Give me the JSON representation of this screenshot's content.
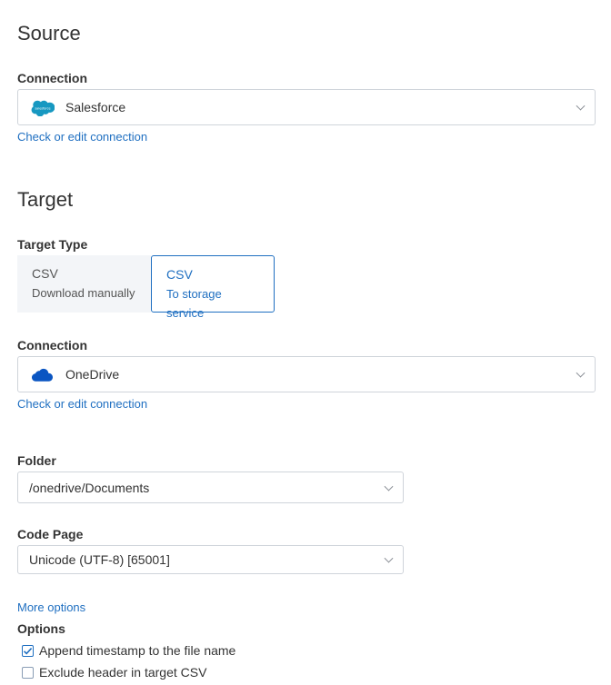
{
  "source": {
    "title": "Source",
    "connection_label": "Connection",
    "connection_value": "Salesforce",
    "connection_icon": "salesforce-icon",
    "edit_link": "Check or edit connection"
  },
  "target": {
    "title": "Target",
    "type_label": "Target Type",
    "types": [
      {
        "title": "CSV",
        "subtitle": "Download manually",
        "selected": false
      },
      {
        "title": "CSV",
        "subtitle": "To storage service",
        "selected": true
      }
    ],
    "connection_label": "Connection",
    "connection_value": "OneDrive",
    "connection_icon": "onedrive-icon",
    "edit_link": "Check or edit connection",
    "folder_label": "Folder",
    "folder_value": "/onedrive/Documents",
    "codepage_label": "Code Page",
    "codepage_value": "Unicode (UTF-8) [65001]",
    "more_options": "More options",
    "options_label": "Options",
    "options": [
      {
        "label": "Append timestamp to the file name",
        "checked": true
      },
      {
        "label": "Exclude header in target CSV",
        "checked": false
      }
    ]
  },
  "colors": {
    "accent": "#1f6fc1",
    "tile_bg": "#f3f5f8",
    "border": "#cfd4da",
    "salesforce": "#1798c1",
    "onedrive": "#0a55c2"
  }
}
